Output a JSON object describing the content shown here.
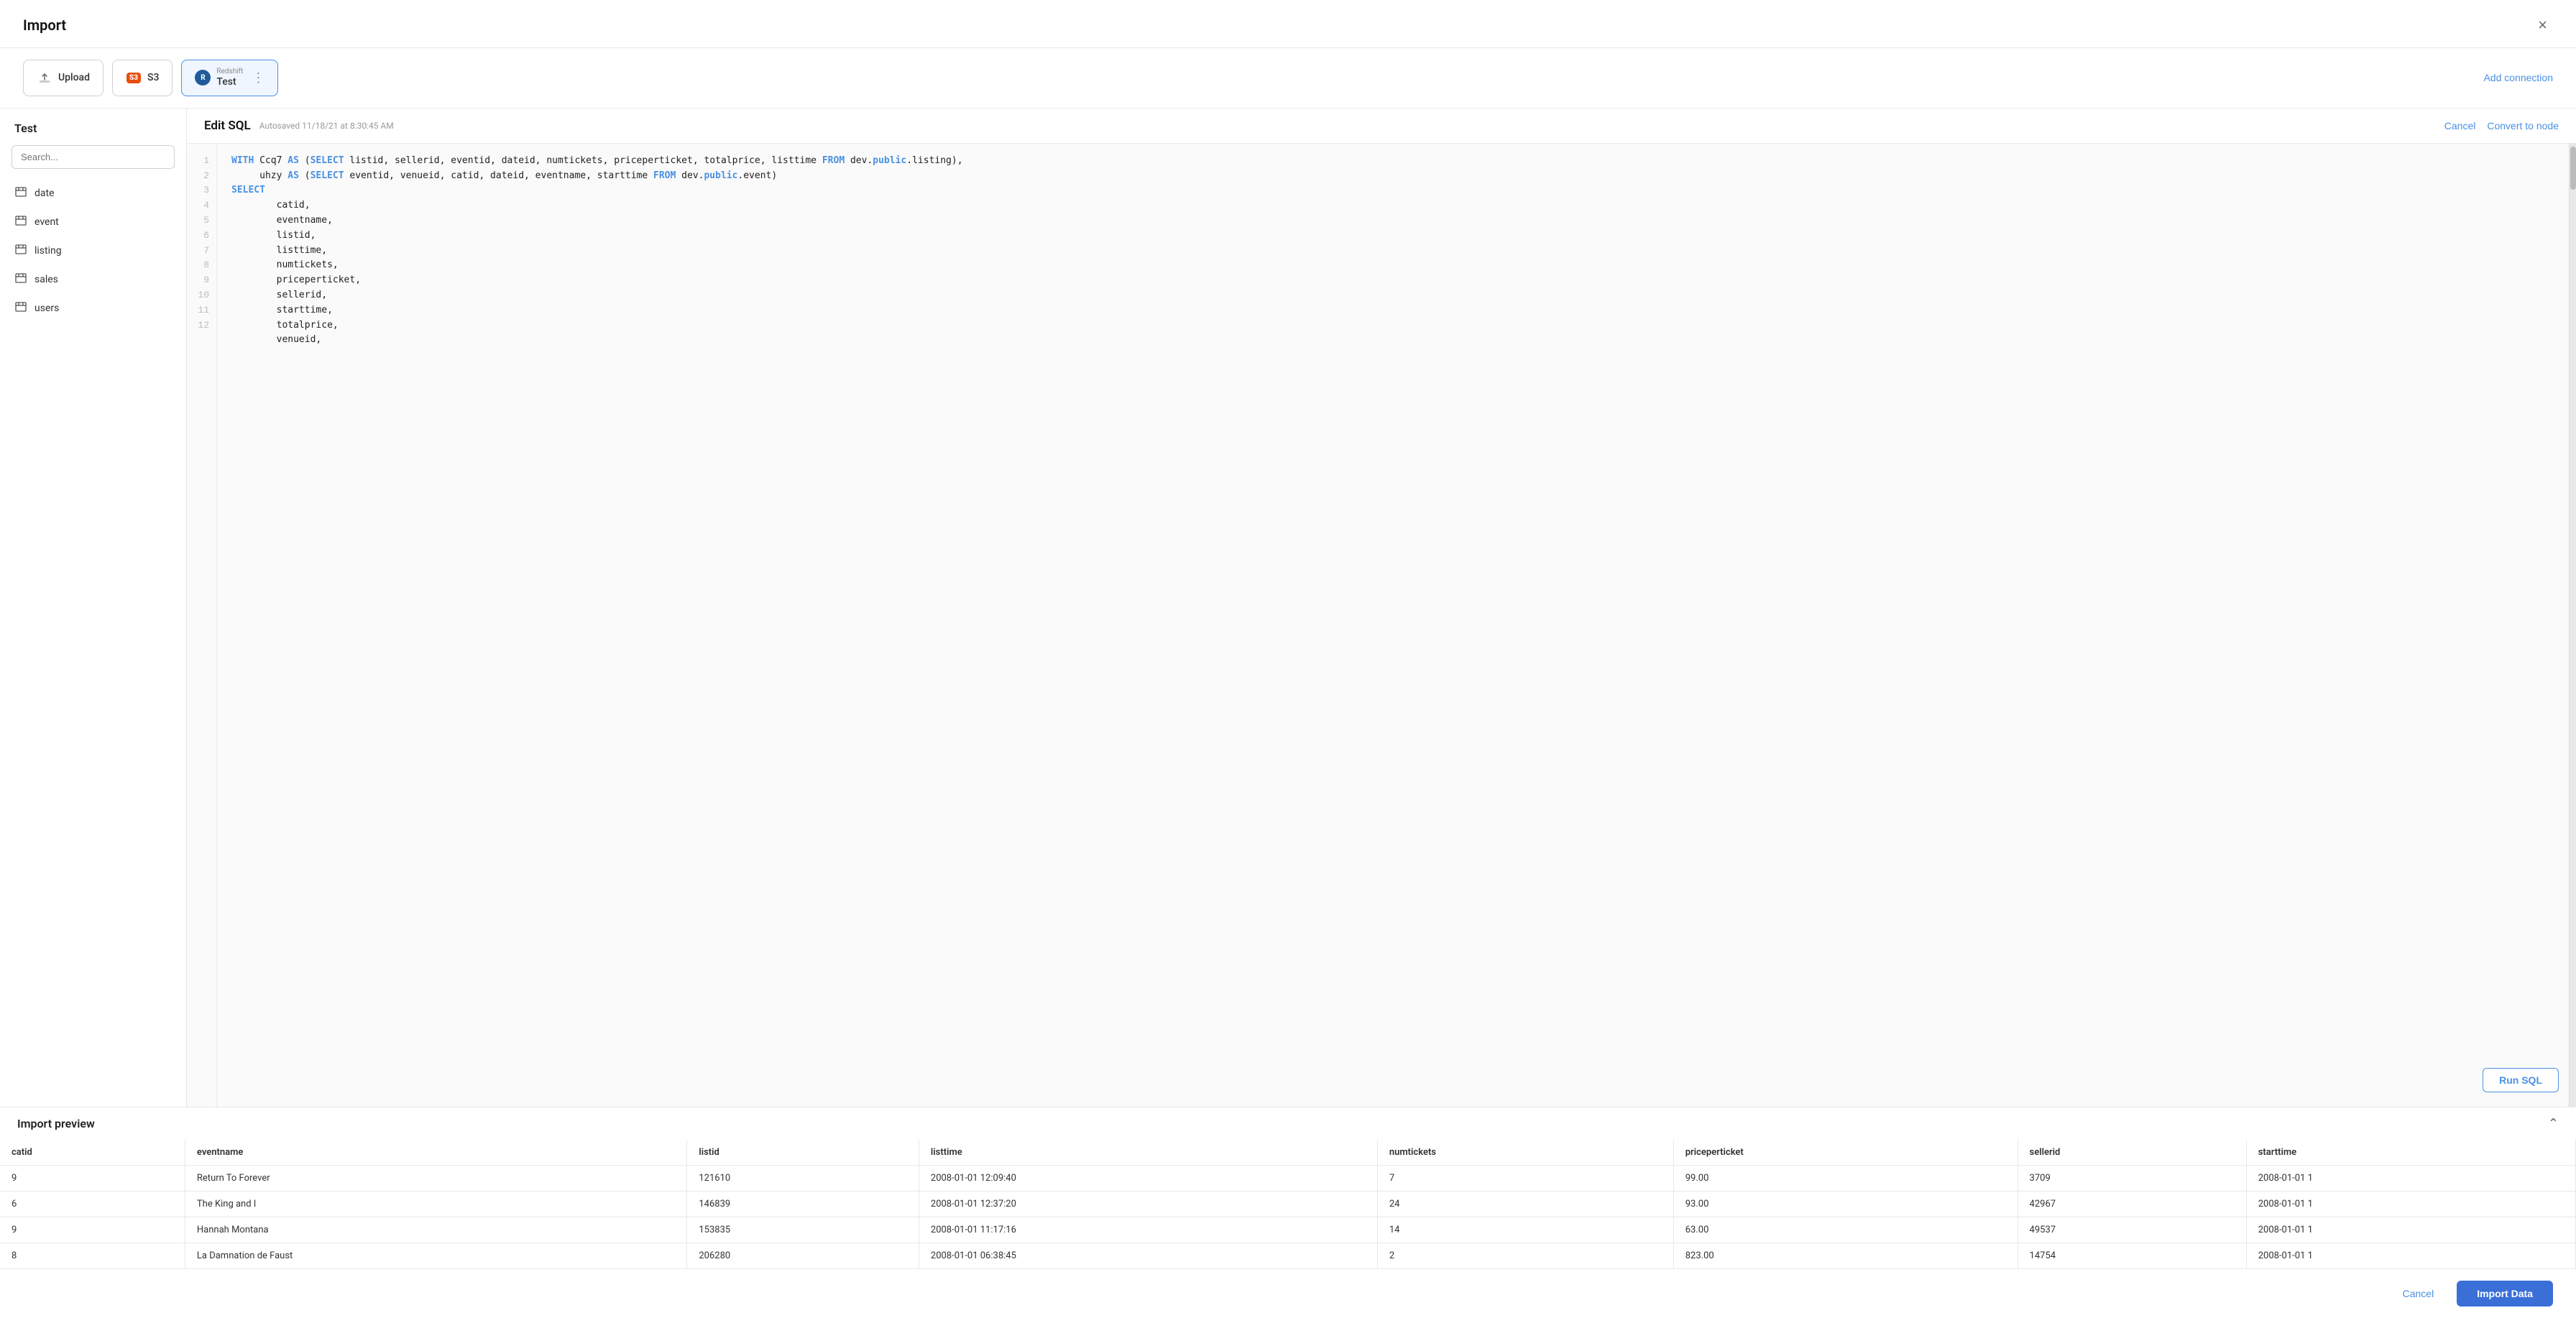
{
  "modal": {
    "title": "Import",
    "close_label": "×"
  },
  "connections": {
    "tabs": [
      {
        "id": "upload",
        "label": "Upload",
        "icon_type": "upload",
        "active": false
      },
      {
        "id": "s3",
        "label": "S3",
        "icon_type": "s3",
        "active": false
      },
      {
        "id": "redshift",
        "label": "Test",
        "subtitle": "Redshift",
        "icon_type": "redshift",
        "active": true
      }
    ],
    "add_connection_label": "Add connection"
  },
  "sidebar": {
    "title": "Test",
    "search_placeholder": "Search...",
    "tables": [
      {
        "name": "date"
      },
      {
        "name": "event"
      },
      {
        "name": "listing"
      },
      {
        "name": "sales"
      },
      {
        "name": "users"
      }
    ]
  },
  "editor": {
    "title": "Edit SQL",
    "autosaved": "Autosaved 11/18/21 at 8:30:45 AM",
    "cancel_label": "Cancel",
    "convert_label": "Convert to node",
    "run_sql_label": "Run SQL",
    "code_lines": [
      "WITH Ccq7 AS (SELECT listid, sellerid, eventid, dateid, numtickets, priceperticket, totalprice, listtime FROM dev.public.listing),",
      "     uhzy AS (SELECT eventid, venueid, catid, dateid, eventname, starttime FROM dev.public.event)",
      "SELECT",
      "        catid,",
      "        eventname,",
      "        listid,",
      "        listtime,",
      "        numtickets,",
      "        priceperticket,",
      "        sellerid,",
      "        starttime,",
      "        totalprice,",
      "        venueid,"
    ],
    "line_count": 12
  },
  "import_preview": {
    "title": "Import preview",
    "collapse_icon": "⌃",
    "columns": [
      "catid",
      "eventname",
      "listid",
      "listtime",
      "numtickets",
      "priceperticket",
      "sellerid",
      "starttime"
    ],
    "rows": [
      {
        "catid": "9",
        "eventname": "Return To Forever",
        "listid": "121610",
        "listtime": "2008-01-01 12:09:40",
        "numtickets": "7",
        "priceperticket": "99.00",
        "sellerid": "3709",
        "starttime": "2008-01-01 1"
      },
      {
        "catid": "6",
        "eventname": "The King and I",
        "listid": "146839",
        "listtime": "2008-01-01 12:37:20",
        "numtickets": "24",
        "priceperticket": "93.00",
        "sellerid": "42967",
        "starttime": "2008-01-01 1"
      },
      {
        "catid": "9",
        "eventname": "Hannah Montana",
        "listid": "153835",
        "listtime": "2008-01-01 11:17:16",
        "numtickets": "14",
        "priceperticket": "63.00",
        "sellerid": "49537",
        "starttime": "2008-01-01 1"
      },
      {
        "catid": "8",
        "eventname": "La Damnation de Faust",
        "listid": "206280",
        "listtime": "2008-01-01 06:38:45",
        "numtickets": "2",
        "priceperticket": "823.00",
        "sellerid": "14754",
        "starttime": "2008-01-01 1"
      }
    ]
  },
  "footer": {
    "cancel_label": "Cancel",
    "import_label": "Import Data"
  },
  "colors": {
    "accent": "#4a90e2",
    "import_btn": "#3a6fd8"
  }
}
